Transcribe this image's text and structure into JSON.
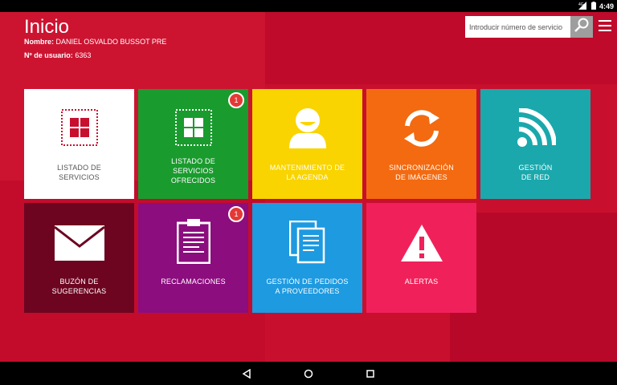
{
  "status": {
    "time": "4:49",
    "network": "4G"
  },
  "header": {
    "title": "Inicio",
    "name_label": "Nombre:",
    "name_value": "DANIEL OSVALDO BUSSOT PRE",
    "user_label": "Nº de usuario:",
    "user_value": "6363"
  },
  "search": {
    "placeholder": "Introducir número de servicio",
    "icon": "search-icon"
  },
  "menu": {
    "icon": "menu-icon"
  },
  "tiles": [
    {
      "line1": "LISTADO DE",
      "line2": "SERVICIOS",
      "icon": "grid-icon",
      "color": "#ffffff"
    },
    {
      "line1": "LISTADO DE",
      "line2": "SERVICIOS",
      "line3": "OFRECIDOS",
      "icon": "grid-icon",
      "color": "#1a9b2e",
      "badge": "1"
    },
    {
      "line1": "MANTENIMIENTO DE",
      "line2": "LA AGENDA",
      "icon": "user-icon",
      "color": "#f9d400"
    },
    {
      "line1": "SINCRONIZACIÓN",
      "line2": "DE IMÁGENES",
      "icon": "sync-icon",
      "color": "#f36a10"
    },
    {
      "line1": "GESTIÓN",
      "line2": "DE RED",
      "icon": "wifi-icon",
      "color": "#1aa8ac"
    },
    {
      "line1": "BUZÓN DE",
      "line2": "SUGERENCIAS",
      "icon": "mail-icon",
      "color": "#6d0520"
    },
    {
      "line1": "RECLAMACIONES",
      "icon": "clipboard-icon",
      "color": "#8b0d7e",
      "badge": "1"
    },
    {
      "line1": "GESTIÓN DE PEDIDOS",
      "line2": "A PROVEEDORES",
      "icon": "documents-icon",
      "color": "#1d9ae0"
    },
    {
      "line1": "ALERTAS",
      "icon": "alert-icon",
      "color": "#f0215a"
    }
  ],
  "colors": {
    "background": "#c8102e",
    "tile_text_dark": "#555555"
  },
  "nav": {
    "back": "back-icon",
    "home": "home-icon",
    "recents": "recents-icon"
  }
}
